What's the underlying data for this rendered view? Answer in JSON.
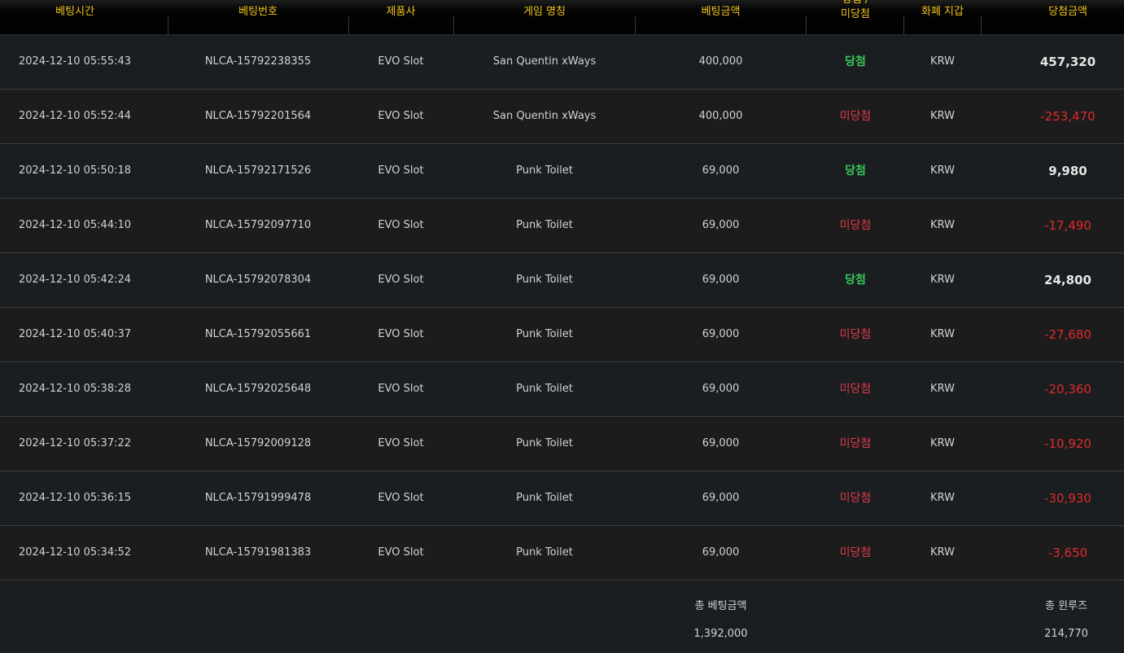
{
  "header": {
    "time": "베팅시간",
    "bet_no": "베팅번호",
    "vendor": "제품사",
    "game": "게임 명칭",
    "bet_amount": "베팅금액",
    "status_line1": "당첨 /",
    "status_line2": "미당첨",
    "currency": "화폐 지갑",
    "win_amount": "당첨금액"
  },
  "rows": [
    {
      "time": "2024-12-10 05:55:43",
      "bet_no": "NLCA-15792238355",
      "vendor": "EVO Slot",
      "game": "San Quentin xWays",
      "bet": "400,000",
      "status": "당첨",
      "result": "win",
      "currency": "KRW",
      "amount": "457,320"
    },
    {
      "time": "2024-12-10 05:52:44",
      "bet_no": "NLCA-15792201564",
      "vendor": "EVO Slot",
      "game": "San Quentin xWays",
      "bet": "400,000",
      "status": "미당첨",
      "result": "lose",
      "currency": "KRW",
      "amount": "-253,470"
    },
    {
      "time": "2024-12-10 05:50:18",
      "bet_no": "NLCA-15792171526",
      "vendor": "EVO Slot",
      "game": "Punk Toilet",
      "bet": "69,000",
      "status": "당첨",
      "result": "win",
      "currency": "KRW",
      "amount": "9,980"
    },
    {
      "time": "2024-12-10 05:44:10",
      "bet_no": "NLCA-15792097710",
      "vendor": "EVO Slot",
      "game": "Punk Toilet",
      "bet": "69,000",
      "status": "미당첨",
      "result": "lose",
      "currency": "KRW",
      "amount": "-17,490"
    },
    {
      "time": "2024-12-10 05:42:24",
      "bet_no": "NLCA-15792078304",
      "vendor": "EVO Slot",
      "game": "Punk Toilet",
      "bet": "69,000",
      "status": "당첨",
      "result": "win",
      "currency": "KRW",
      "amount": "24,800"
    },
    {
      "time": "2024-12-10 05:40:37",
      "bet_no": "NLCA-15792055661",
      "vendor": "EVO Slot",
      "game": "Punk Toilet",
      "bet": "69,000",
      "status": "미당첨",
      "result": "lose",
      "currency": "KRW",
      "amount": "-27,680"
    },
    {
      "time": "2024-12-10 05:38:28",
      "bet_no": "NLCA-15792025648",
      "vendor": "EVO Slot",
      "game": "Punk Toilet",
      "bet": "69,000",
      "status": "미당첨",
      "result": "lose",
      "currency": "KRW",
      "amount": "-20,360"
    },
    {
      "time": "2024-12-10 05:37:22",
      "bet_no": "NLCA-15792009128",
      "vendor": "EVO Slot",
      "game": "Punk Toilet",
      "bet": "69,000",
      "status": "미당첨",
      "result": "lose",
      "currency": "KRW",
      "amount": "-10,920"
    },
    {
      "time": "2024-12-10 05:36:15",
      "bet_no": "NLCA-15791999478",
      "vendor": "EVO Slot",
      "game": "Punk Toilet",
      "bet": "69,000",
      "status": "미당첨",
      "result": "lose",
      "currency": "KRW",
      "amount": "-30,930"
    },
    {
      "time": "2024-12-10 05:34:52",
      "bet_no": "NLCA-15791981383",
      "vendor": "EVO Slot",
      "game": "Punk Toilet",
      "bet": "69,000",
      "status": "미당첨",
      "result": "lose",
      "currency": "KRW",
      "amount": "-3,650"
    }
  ],
  "footer": {
    "total_bet_label": "총 베팅금액",
    "total_bet_value": "1,392,000",
    "total_win_label": "총 윈루즈",
    "total_win_value": "214,770"
  },
  "colors": {
    "header_text": "#f2c31b",
    "win": "#38c55a",
    "lose": "#e1394b",
    "negative_amount": "#e02a2a"
  }
}
